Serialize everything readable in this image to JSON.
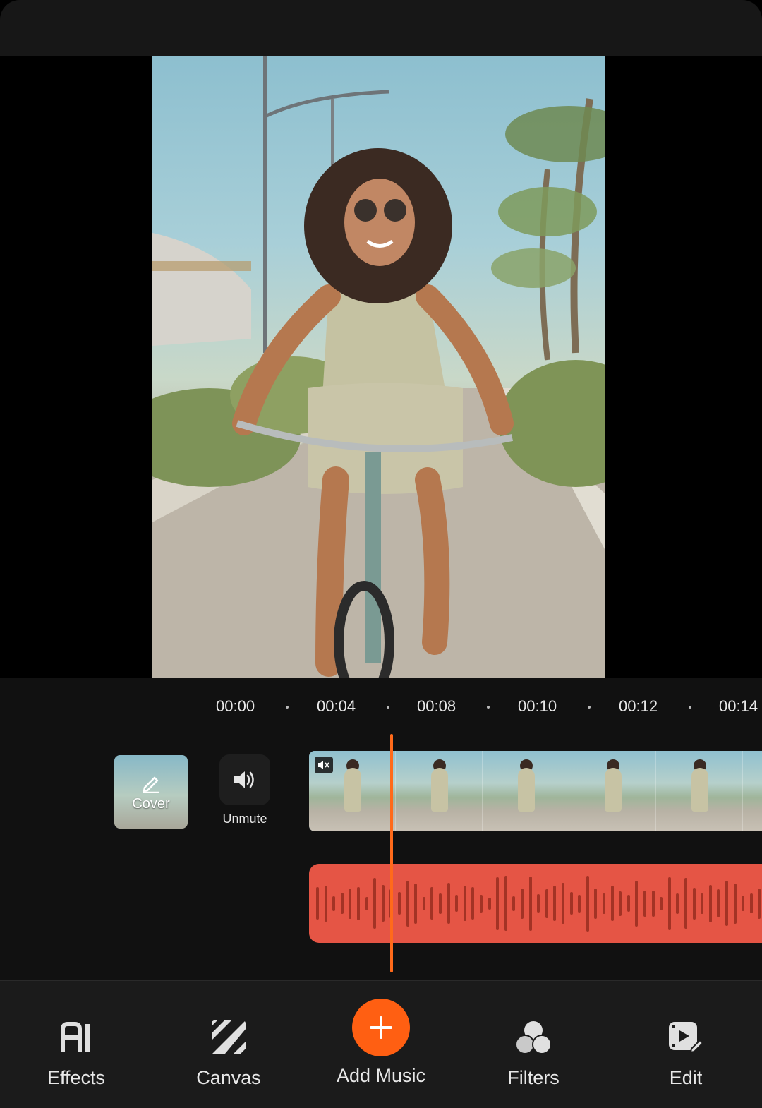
{
  "timeline": {
    "ticks": [
      "00:00",
      "00:04",
      "00:08",
      "00:10",
      "00:12",
      "00:14"
    ]
  },
  "cover": {
    "label": "Cover",
    "icon": "pencil-icon"
  },
  "audio_toggle": {
    "label": "Unmute",
    "icon": "speaker-icon"
  },
  "video_track": {
    "muted_icon": "mute-icon",
    "frame_count": 6
  },
  "audio_track": {
    "color": "#e55545",
    "wave_color": "#a33325"
  },
  "playhead": {
    "color": "#ff6a1a"
  },
  "bottom_nav": {
    "items": [
      {
        "label": "Effects",
        "icon": "ai-icon"
      },
      {
        "label": "Canvas",
        "icon": "canvas-stripes-icon"
      },
      {
        "label": "Add Music",
        "icon": "plus-icon"
      },
      {
        "label": "Filters",
        "icon": "filters-circles-icon"
      },
      {
        "label": "Edit",
        "icon": "edit-video-icon"
      }
    ],
    "accent": "#ff5f12"
  }
}
